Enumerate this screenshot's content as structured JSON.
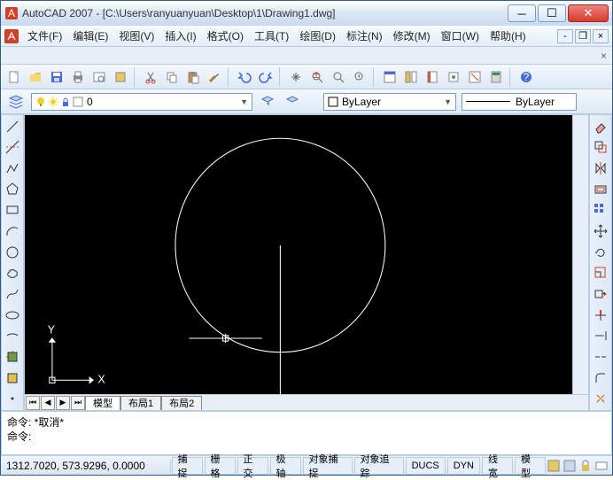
{
  "window": {
    "title": "AutoCAD 2007 - [C:\\Users\\ranyuanyuan\\Desktop\\1\\Drawing1.dwg]"
  },
  "menus": [
    {
      "label": "文件(F)"
    },
    {
      "label": "编辑(E)"
    },
    {
      "label": "视图(V)"
    },
    {
      "label": "插入(I)"
    },
    {
      "label": "格式(O)"
    },
    {
      "label": "工具(T)"
    },
    {
      "label": "绘图(D)"
    },
    {
      "label": "标注(N)"
    },
    {
      "label": "修改(M)"
    },
    {
      "label": "窗口(W)"
    },
    {
      "label": "帮助(H)"
    }
  ],
  "layer": {
    "current": "0"
  },
  "props": {
    "color": "ByLayer",
    "linetype": "ByLayer"
  },
  "canvas": {
    "ucs_x": "X",
    "ucs_y": "Y"
  },
  "tabs": {
    "model": "模型",
    "layout1": "布局1",
    "layout2": "布局2"
  },
  "command": {
    "line1": "命令: *取消*",
    "line2": "命令:"
  },
  "status": {
    "coords": "1312.7020, 573.9296, 0.0000",
    "buttons": [
      "捕捉",
      "栅格",
      "正交",
      "极轴",
      "对象捕捉",
      "对象追踪",
      "DUCS",
      "DYN",
      "线宽",
      "模型"
    ]
  }
}
